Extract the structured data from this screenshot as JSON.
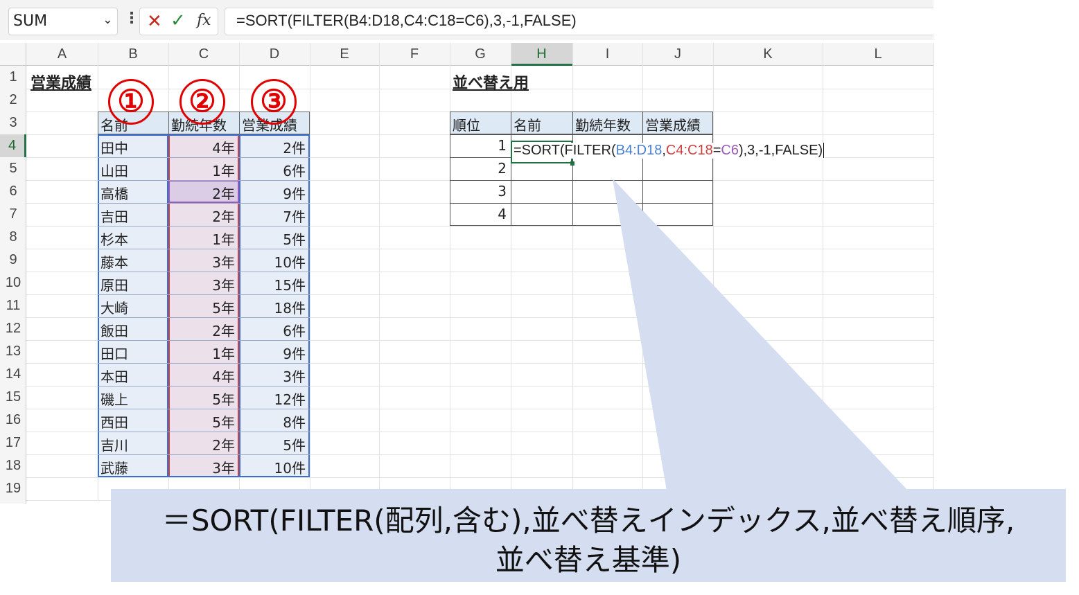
{
  "name_box": {
    "value": "SUM"
  },
  "formula_bar": {
    "formula": "=SORT(FILTER(B4:D18,C4:C18=C6),3,-1,FALSE)",
    "fx": "fx"
  },
  "columns": [
    "A",
    "B",
    "C",
    "D",
    "E",
    "F",
    "G",
    "H",
    "I",
    "J",
    "K",
    "L"
  ],
  "rows": [
    "1",
    "2",
    "3",
    "4",
    "5",
    "6",
    "7",
    "8",
    "9",
    "10",
    "11",
    "12",
    "13",
    "14",
    "15",
    "16",
    "17",
    "18",
    "19"
  ],
  "left_table": {
    "title": "営業成績",
    "headers": [
      "名前",
      "勤続年数",
      "営業成績"
    ],
    "rows": [
      [
        "田中",
        "4年",
        "2件"
      ],
      [
        "山田",
        "1年",
        "6件"
      ],
      [
        "高橋",
        "2年",
        "9件"
      ],
      [
        "吉田",
        "2年",
        "7件"
      ],
      [
        "杉本",
        "1年",
        "5件"
      ],
      [
        "藤本",
        "3年",
        "10件"
      ],
      [
        "原田",
        "3年",
        "15件"
      ],
      [
        "大崎",
        "5年",
        "18件"
      ],
      [
        "飯田",
        "2年",
        "6件"
      ],
      [
        "田口",
        "1年",
        "9件"
      ],
      [
        "本田",
        "4年",
        "3件"
      ],
      [
        "磯上",
        "5年",
        "12件"
      ],
      [
        "西田",
        "5年",
        "8件"
      ],
      [
        "吉川",
        "2年",
        "5件"
      ],
      [
        "武藤",
        "3年",
        "10件"
      ]
    ]
  },
  "markers": [
    "①",
    "②",
    "③"
  ],
  "right_table": {
    "title": "並べ替え用",
    "headers": [
      "順位",
      "名前",
      "勤続年数",
      "営業成績"
    ],
    "ranks": [
      "1",
      "2",
      "3",
      "4"
    ],
    "formula_parts": {
      "p1": "=SORT(FILTER(",
      "p2": "B4:D18",
      "p3": ",",
      "p4": "C4:C18",
      "p5": "=",
      "p6": "C6",
      "p7": "),3,-1,FALSE)"
    }
  },
  "callout": {
    "line1": "＝SORT(FILTER(配列,含む),並べ替えインデックス,並べ替え順序,",
    "line2": "並べ替え基準)"
  },
  "colors": {
    "excel_green": "#217346",
    "ref_blue": "#4a7fd4",
    "ref_red": "#d04040",
    "ref_purple": "#9b59b6",
    "callout_bg": "#d5ddf0"
  }
}
